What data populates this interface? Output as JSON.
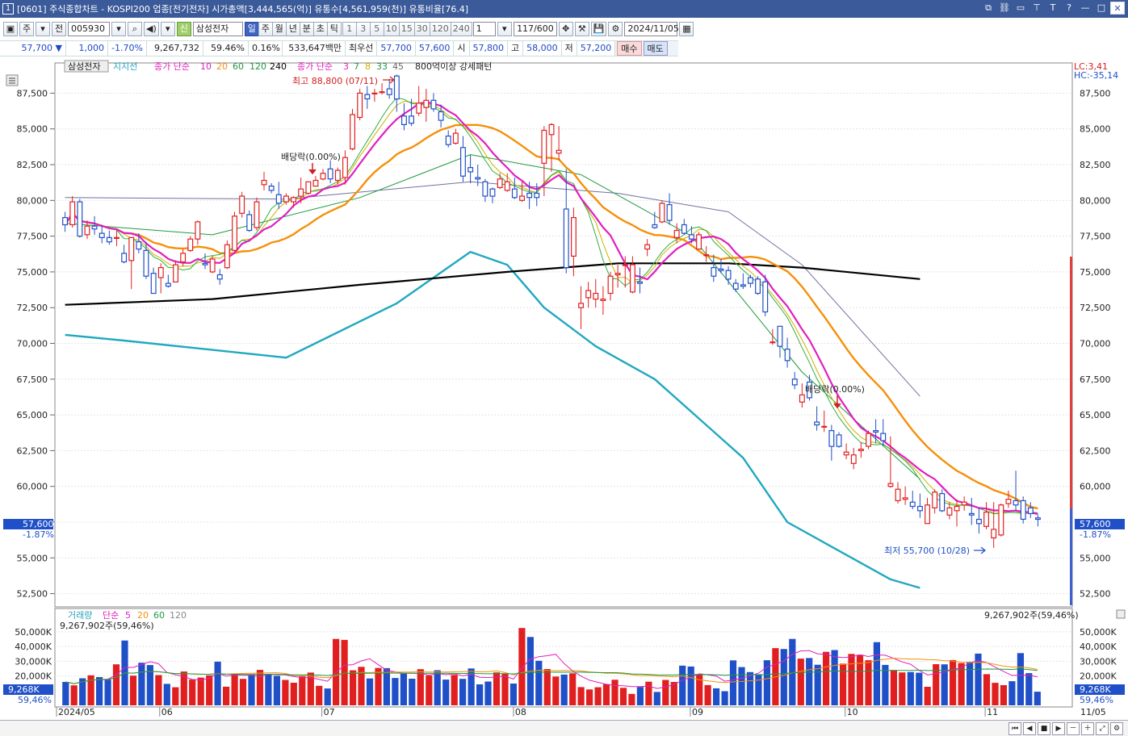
{
  "window": {
    "number": "1",
    "title": "[0601] 주식종합차트 - KOSPI200 업종[전기전자] 시가총액[3,444,565(억)] 유통수[4,561,959(천)] 유통비율[76.4]"
  },
  "toolbar": {
    "period_select": "주",
    "prefix_btn": "전",
    "code": "005930",
    "badge": "신",
    "stock_name": "삼성전자",
    "periods": [
      "일",
      "주",
      "월",
      "년",
      "분",
      "초",
      "틱"
    ],
    "active_period": "일",
    "intervals": [
      "1",
      "3",
      "5",
      "10",
      "15",
      "30",
      "120",
      "240"
    ],
    "interval_input": "1",
    "count": "117",
    "count_total": "/600",
    "date": "2024/11/05"
  },
  "quote": {
    "price": "57,700",
    "arrow": "▼",
    "change": "1,000",
    "change_pct": "-1.70%",
    "volume": "9,267,732",
    "vol_ratio": "59.46%",
    "turnover": "0.16%",
    "amount": "533,647백만",
    "best_label": "최우선",
    "best_ask": "57,700",
    "best_bid": "57,600",
    "open_label": "시",
    "open": "57,800",
    "high_label": "고",
    "high": "58,000",
    "low_label": "저",
    "low": "57,200",
    "buy": "매수",
    "sell": "매도"
  },
  "legend": {
    "stock_tag": "삼성전자",
    "support": "지지선",
    "ma_label": "종가 단순",
    "ma_periods": [
      "10",
      "20",
      "60",
      "120",
      "240"
    ],
    "ma2_label": "종가 단순",
    "ma2_periods": [
      "3",
      "7",
      "8",
      "33",
      "45"
    ],
    "pattern": "800억이상 강세패턴"
  },
  "annotations": {
    "high": "최고 88,800 (07/11)",
    "low": "최저 55,700 (10/28)",
    "ex_div_1": "배당락(0.00%)",
    "ex_div_2": "배당락(0.00%)"
  },
  "right_info": {
    "lc": "LC:3,41",
    "hc": "HC:-35,14"
  },
  "current_tag": {
    "price": "57,600",
    "pct": "-1.87%"
  },
  "volume_panel": {
    "label": "거래량",
    "ma_label": "단순",
    "ma_periods": [
      "5",
      "20",
      "60",
      "120"
    ],
    "current": "9,267,902주(59,46%)",
    "right_current": "9,267,902주(59,46%)",
    "tag_value": "9,268K",
    "tag_pct": "59,46%"
  },
  "colors": {
    "up": "#e02020",
    "down": "#2050c8",
    "ma10": "#e020c0",
    "ma20": "#f5900a",
    "ma60": "#1e9a40",
    "ma120": "#808080",
    "ma240": "#000000",
    "support": "#20a8c0"
  },
  "chart_data": {
    "type": "candlestick",
    "price_axis": {
      "ticks": [
        "87,500",
        "85,000",
        "82,500",
        "80,000",
        "77,500",
        "75,000",
        "72,500",
        "70,000",
        "67,500",
        "65,000",
        "62,500",
        "60,000",
        "57,500",
        "55,000",
        "52,500"
      ],
      "ylim": [
        51800,
        89500
      ]
    },
    "volume_axis": {
      "ticks": [
        "50,000K",
        "40,000K",
        "30,000K",
        "20,000K"
      ],
      "ylim": [
        0,
        56000
      ]
    },
    "x_labels": [
      "2024/05",
      "06",
      "07",
      "08",
      "09",
      "10",
      "11",
      "11/05"
    ],
    "candles": [
      [
        78800,
        79200,
        77800,
        78300
      ],
      [
        78300,
        80300,
        78100,
        79900
      ],
      [
        79900,
        80100,
        77400,
        77500
      ],
      [
        77600,
        78600,
        77300,
        78200
      ],
      [
        78200,
        78900,
        77600,
        78000
      ],
      [
        77700,
        78300,
        77000,
        77400
      ],
      [
        77400,
        77900,
        76900,
        77100
      ],
      [
        77400,
        77900,
        76800,
        77400
      ],
      [
        76300,
        76900,
        75600,
        75700
      ],
      [
        75800,
        77400,
        73800,
        77400
      ],
      [
        77100,
        77700,
        76300,
        76600
      ],
      [
        76500,
        77100,
        74500,
        74700
      ],
      [
        74900,
        75300,
        73500,
        73500
      ],
      [
        74600,
        75600,
        73500,
        75300
      ],
      [
        74200,
        74800,
        73900,
        74000
      ],
      [
        74300,
        75800,
        74300,
        75500
      ],
      [
        75700,
        76600,
        75400,
        76300
      ],
      [
        76500,
        77500,
        76400,
        77300
      ],
      [
        77300,
        78600,
        76900,
        78500
      ],
      [
        75600,
        76300,
        75200,
        75500
      ],
      [
        75000,
        76100,
        74900,
        75900
      ],
      [
        74800,
        75200,
        74100,
        74500
      ],
      [
        75300,
        77200,
        75200,
        76900
      ],
      [
        76500,
        79200,
        76400,
        78900
      ],
      [
        79100,
        80600,
        78800,
        80300
      ],
      [
        79000,
        79300,
        77800,
        77900
      ],
      [
        78100,
        80200,
        77900,
        79900
      ],
      [
        81100,
        82000,
        80700,
        81400
      ],
      [
        81000,
        81200,
        80500,
        80700
      ],
      [
        80400,
        81300,
        79400,
        79800
      ],
      [
        79900,
        80500,
        79700,
        80300
      ],
      [
        79900,
        80300,
        79500,
        80200
      ],
      [
        80300,
        81600,
        79800,
        80800
      ],
      [
        80500,
        81300,
        80400,
        81300
      ],
      [
        81000,
        81700,
        81000,
        81400
      ],
      [
        81500,
        82200,
        81400,
        81900
      ],
      [
        82200,
        82800,
        81200,
        81500
      ],
      [
        81400,
        82300,
        81100,
        82100
      ],
      [
        81600,
        83500,
        81100,
        83000
      ],
      [
        83600,
        86400,
        83500,
        86000
      ],
      [
        85800,
        87800,
        85600,
        87500
      ],
      [
        87400,
        88000,
        86400,
        87100
      ],
      [
        87500,
        87800,
        86900,
        87500
      ],
      [
        87600,
        88200,
        87400,
        87600
      ],
      [
        87800,
        88500,
        87100,
        87400
      ],
      [
        88700,
        88800,
        86200,
        87100
      ],
      [
        85900,
        86800,
        84900,
        85300
      ],
      [
        85900,
        87100,
        85200,
        85400
      ],
      [
        86100,
        88000,
        85900,
        86800
      ],
      [
        86500,
        87800,
        85500,
        87000
      ],
      [
        87000,
        87500,
        86200,
        86400
      ],
      [
        86200,
        86700,
        85100,
        85600
      ],
      [
        84500,
        84900,
        83700,
        83900
      ],
      [
        84000,
        85000,
        83900,
        84700
      ],
      [
        83700,
        84500,
        81300,
        81700
      ],
      [
        82300,
        83200,
        81200,
        82000
      ],
      [
        81600,
        82500,
        81000,
        81500
      ],
      [
        81300,
        81500,
        79900,
        80300
      ],
      [
        80800,
        80900,
        79800,
        80300
      ],
      [
        80900,
        81900,
        80800,
        81500
      ],
      [
        80700,
        81900,
        80600,
        81300
      ],
      [
        80800,
        81600,
        80100,
        80200
      ],
      [
        80000,
        81300,
        79900,
        80300
      ],
      [
        80500,
        81300,
        79400,
        80200
      ],
      [
        80500,
        81200,
        79600,
        80200
      ],
      [
        82600,
        85200,
        80300,
        84900
      ],
      [
        84600,
        85400,
        82000,
        85300
      ],
      [
        83300,
        85200,
        82800,
        83500
      ],
      [
        79400,
        82200,
        74900,
        75300
      ],
      [
        76100,
        79500,
        74700,
        78800
      ],
      [
        72500,
        74000,
        71000,
        72800
      ],
      [
        73200,
        74300,
        72500,
        73700
      ],
      [
        73100,
        74500,
        72500,
        73500
      ],
      [
        73000,
        74000,
        72000,
        73100
      ],
      [
        73500,
        75000,
        73000,
        74700
      ],
      [
        74800,
        75500,
        73900,
        74900
      ],
      [
        75500,
        76100,
        73900,
        75500
      ],
      [
        73600,
        76100,
        73500,
        75500
      ],
      [
        74300,
        75300,
        73500,
        74200
      ],
      [
        76600,
        77300,
        76100,
        76900
      ],
      [
        78300,
        79200,
        78000,
        78100
      ],
      [
        78500,
        80000,
        78400,
        79800
      ],
      [
        79700,
        80500,
        78300,
        78600
      ],
      [
        77400,
        78400,
        77000,
        77900
      ],
      [
        78300,
        78700,
        77600,
        77700
      ],
      [
        77600,
        78200,
        77000,
        77300
      ],
      [
        76600,
        77800,
        76600,
        77600
      ],
      [
        76200,
        76800,
        75700,
        76200
      ],
      [
        75300,
        76200,
        74300,
        74700
      ],
      [
        75200,
        75900,
        74900,
        75100
      ],
      [
        75100,
        75400,
        74100,
        74500
      ],
      [
        74200,
        74500,
        73600,
        73800
      ],
      [
        74100,
        74900,
        73800,
        74000
      ],
      [
        74600,
        74800,
        73900,
        74200
      ],
      [
        74500,
        74700,
        73400,
        73500
      ],
      [
        74300,
        74800,
        71900,
        72200
      ],
      [
        70100,
        71000,
        69900,
        70100
      ],
      [
        71200,
        71200,
        69000,
        69800
      ],
      [
        69600,
        70400,
        68300,
        68800
      ],
      [
        67500,
        68000,
        66800,
        67100
      ],
      [
        65900,
        67200,
        65500,
        66400
      ],
      [
        67300,
        67800,
        66000,
        66200
      ],
      [
        64500,
        65600,
        63900,
        64300
      ],
      [
        64200,
        65300,
        63800,
        64200
      ],
      [
        63900,
        64300,
        61800,
        62800
      ],
      [
        63600,
        63800,
        62700,
        62800
      ],
      [
        62200,
        63000,
        61900,
        62400
      ],
      [
        61600,
        62700,
        61200,
        62200
      ],
      [
        62500,
        63100,
        62000,
        62600
      ],
      [
        62800,
        63900,
        62600,
        63700
      ],
      [
        63900,
        64700,
        63000,
        63800
      ],
      [
        63700,
        64700,
        62800,
        63200
      ],
      [
        60000,
        63500,
        59900,
        60200
      ],
      [
        59000,
        60300,
        58800,
        59800
      ],
      [
        59100,
        60000,
        58700,
        59200
      ],
      [
        58900,
        59700,
        58400,
        58600
      ],
      [
        58600,
        59500,
        57800,
        58300
      ],
      [
        57400,
        59200,
        57400,
        58700
      ],
      [
        58500,
        59800,
        58100,
        59600
      ],
      [
        59500,
        59800,
        58200,
        58300
      ],
      [
        58000,
        58900,
        57700,
        58500
      ],
      [
        58300,
        59100,
        57200,
        58600
      ],
      [
        58700,
        59300,
        58300,
        58900
      ],
      [
        58100,
        59200,
        57300,
        58000
      ],
      [
        57700,
        58500,
        56700,
        57400
      ],
      [
        57200,
        58900,
        57000,
        58200
      ],
      [
        56400,
        58900,
        55700,
        57000
      ],
      [
        56600,
        58800,
        56500,
        58700
      ],
      [
        58800,
        59700,
        58500,
        59100
      ],
      [
        59000,
        61100,
        58300,
        58700
      ],
      [
        59000,
        59300,
        57400,
        57700
      ],
      [
        58500,
        58900,
        57800,
        58100
      ],
      [
        57800,
        58000,
        57200,
        57700
      ]
    ],
    "volumes": [
      15.9,
      13.6,
      18.4,
      20.4,
      19.2,
      17.5,
      27.9,
      44.1,
      20.2,
      29.0,
      27.4,
      20.6,
      14.6,
      12.3,
      23.0,
      17.5,
      18.9,
      20.4,
      29.7,
      12.7,
      21.4,
      18.0,
      21.0,
      24.1,
      21.1,
      20.1,
      17.3,
      15.4,
      19.7,
      22.3,
      13.3,
      11.5,
      45.2,
      44.5,
      23.8,
      26.2,
      18.3,
      25.4,
      25.3,
      18.6,
      21.6,
      18.1,
      24.6,
      20.3,
      23.9,
      17.5,
      20.7,
      18.0,
      25.1,
      14.3,
      16.2,
      22.4,
      21.4,
      14.8,
      52.6,
      46.5,
      30.3,
      24.7,
      19.6,
      20.9,
      21.8,
      12.4,
      10.8,
      12.3,
      14.4,
      17.4,
      11.9,
      7.8,
      12.5,
      16.1,
      9.1,
      17.3,
      15.9,
      27.0,
      26.4,
      20.8,
      13.8,
      11.6,
      9.6,
      30.6,
      26.0,
      22.6,
      20.7,
      30.7,
      38.9,
      38.3,
      45.2,
      31.8,
      32.2,
      27.6,
      36.4,
      37.6,
      28.4,
      35.0,
      34.4,
      30.7,
      43.0,
      27.5,
      24.0,
      22.4,
      22.7,
      22.2,
      12.6,
      28.0,
      27.9,
      30.8,
      28.7,
      29.6,
      35.2,
      21.2,
      15.3,
      13.7,
      16.4,
      35.5,
      21.9,
      9.3
    ],
    "support_line": [
      [
        0,
        70600
      ],
      [
        8,
        70200
      ],
      [
        30,
        69000
      ],
      [
        45,
        72800
      ],
      [
        55,
        76400
      ],
      [
        60,
        75500
      ],
      [
        65,
        72500
      ],
      [
        72,
        69800
      ],
      [
        80,
        67500
      ],
      [
        92,
        62000
      ],
      [
        98,
        57500
      ],
      [
        112,
        53500
      ],
      [
        116,
        52900
      ]
    ],
    "ma240_line": [
      [
        0,
        72700
      ],
      [
        20,
        73100
      ],
      [
        40,
        74100
      ],
      [
        60,
        75000
      ],
      [
        75,
        75600
      ],
      [
        90,
        75600
      ],
      [
        100,
        75300
      ],
      [
        116,
        74500
      ]
    ],
    "ma120_line": [
      [
        0,
        80200
      ],
      [
        30,
        80100
      ],
      [
        55,
        81300
      ],
      [
        75,
        80500
      ],
      [
        90,
        79200
      ],
      [
        100,
        75500
      ],
      [
        116,
        66300
      ]
    ],
    "ma60_line": [
      [
        0,
        78400
      ],
      [
        20,
        77600
      ],
      [
        40,
        80200
      ],
      [
        55,
        83200
      ],
      [
        70,
        81800
      ],
      [
        85,
        77500
      ],
      [
        100,
        68000
      ],
      [
        116,
        60500
      ]
    ]
  }
}
